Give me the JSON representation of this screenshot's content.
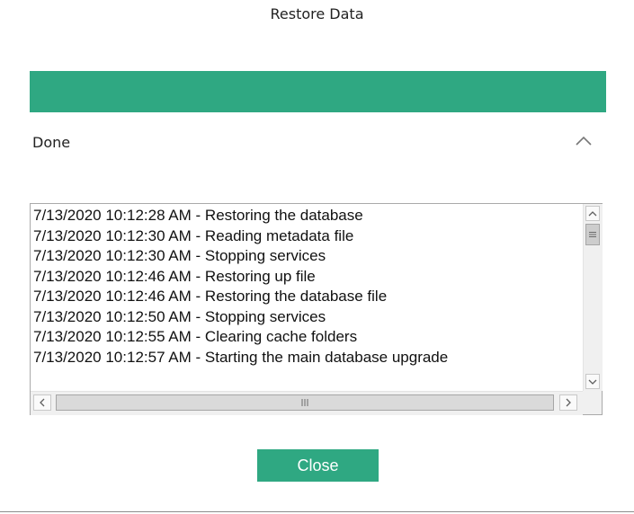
{
  "dialog": {
    "title": "Restore Data",
    "status": "Done",
    "progress_fraction": 1.0,
    "accent_color": "#2fa882"
  },
  "log": {
    "lines": [
      "7/13/2020 10:12:28 AM - Restoring the database",
      "7/13/2020 10:12:30 AM - Reading metadata file",
      "7/13/2020 10:12:30 AM - Stopping services",
      "7/13/2020 10:12:46 AM - Restoring up file",
      "7/13/2020 10:12:46 AM - Restoring the database file",
      "7/13/2020 10:12:50 AM - Stopping services",
      "7/13/2020 10:12:55 AM - Clearing cache folders",
      "7/13/2020 10:12:57 AM - Starting the main database upgrade"
    ]
  },
  "icons": {
    "collapse": "chevron-up-icon",
    "scroll_up": "triangle-up-icon",
    "scroll_down": "triangle-down-icon",
    "scroll_left": "triangle-left-icon",
    "scroll_right": "triangle-right-icon"
  },
  "actions": {
    "close_label": "Close"
  }
}
